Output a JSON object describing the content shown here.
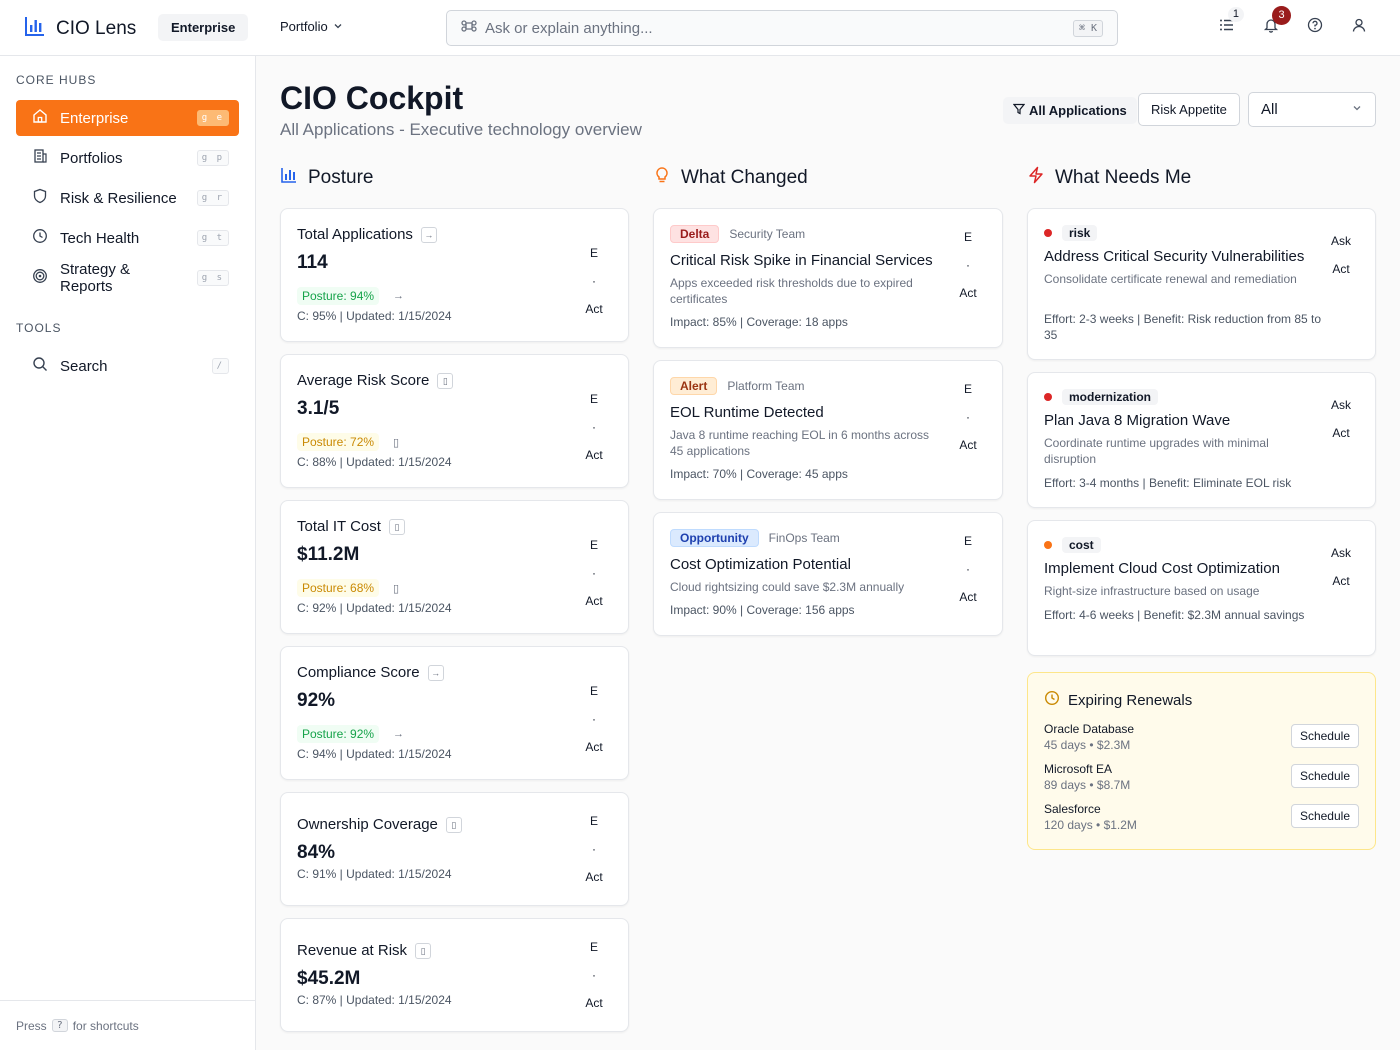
{
  "app": {
    "title": "CIO Lens",
    "env_badge": "Enterprise",
    "portfolio_label": "Portfolio"
  },
  "search": {
    "placeholder": "Ask or explain anything...",
    "shortcut": "⌘ K"
  },
  "top_icons": {
    "tasks_count": "1",
    "notifications_count": "3"
  },
  "sidebar": {
    "core_heading": "CORE HUBS",
    "tools_heading": "TOOLS",
    "items": [
      {
        "label": "Enterprise",
        "shortcut": "g e",
        "icon": "home-icon"
      },
      {
        "label": "Portfolios",
        "shortcut": "g p",
        "icon": "building-icon"
      },
      {
        "label": "Risk & Resilience",
        "shortcut": "g r",
        "icon": "shield-icon"
      },
      {
        "label": "Tech Health",
        "shortcut": "g t",
        "icon": "clock-icon"
      },
      {
        "label": "Strategy & Reports",
        "shortcut": "g s",
        "icon": "target-icon"
      }
    ],
    "tools": [
      {
        "label": "Search",
        "shortcut": "/",
        "icon": "search-icon"
      }
    ],
    "footer": {
      "prefix": "Press",
      "key": "?",
      "suffix": "for shortcuts"
    }
  },
  "header": {
    "title": "CIO Cockpit",
    "subtitle": "All Applications - Executive technology overview",
    "filter_label": "All Applications",
    "risk_button": "Risk Appetite",
    "select_value": "All"
  },
  "sections": {
    "posture": "Posture",
    "changed": "What Changed",
    "needs": "What Needs Me"
  },
  "metrics": [
    {
      "label": "Total Applications",
      "value": "114",
      "posture": "Posture: 94%",
      "trend": "→",
      "meta": "C: 95% | Updated: 1/15/2024",
      "e": "E",
      "dot": "·",
      "act": "Act"
    },
    {
      "label": "Average Risk Score",
      "value": "3.1/5",
      "posture": "Posture: 72%",
      "trend": "▯",
      "meta": "C: 88% | Updated: 1/15/2024",
      "e": "E",
      "dot": "·",
      "act": "Act"
    },
    {
      "label": "Total IT Cost",
      "value": "$11.2M",
      "posture": "Posture: 68%",
      "trend": "▯",
      "meta": "C: 92% | Updated: 1/15/2024",
      "e": "E",
      "dot": "·",
      "act": "Act"
    },
    {
      "label": "Compliance Score",
      "value": "92%",
      "posture": "Posture: 92%",
      "trend": "→",
      "meta": "C: 94% | Updated: 1/15/2024",
      "e": "E",
      "dot": "·",
      "act": "Act"
    },
    {
      "label": "Ownership Coverage",
      "value": "84%",
      "meta": "C: 91% | Updated: 1/15/2024",
      "e": "E",
      "dot": "·",
      "act": "Act"
    },
    {
      "label": "Revenue at Risk",
      "value": "$45.2M",
      "meta": "C: 87% | Updated: 1/15/2024",
      "e": "E",
      "dot": "·",
      "act": "Act"
    }
  ],
  "metric_icons": [
    "→",
    "▯",
    "▯",
    "→",
    "▯",
    "▯"
  ],
  "changes": [
    {
      "tag": "Delta",
      "team": "Security Team",
      "title": "Critical Risk Spike in Financial Services",
      "desc": "Apps exceeded risk thresholds due to expired certificates",
      "meta": "Impact: 85% | Coverage: 18 apps"
    },
    {
      "tag": "Alert",
      "team": "Platform Team",
      "title": "EOL Runtime Detected",
      "desc": "Java 8 runtime reaching EOL in 6 months across 45 applications",
      "meta": "Impact: 70% | Coverage: 45 apps"
    },
    {
      "tag": "Opportunity",
      "team": "FinOps Team",
      "title": "Cost Optimization Potential",
      "desc": "Cloud rightsizing could save $2.3M annually",
      "meta": "Impact: 90% | Coverage: 156 apps"
    }
  ],
  "needs": [
    {
      "tag": "risk",
      "color": "#dc2626",
      "title": "Address Critical Security Vulnerabilities",
      "desc": "Consolidate certificate renewal and remediation",
      "meta": "Effort: 2-3 weeks | Benefit: Risk reduction from 85 to 35",
      "ask": "Ask",
      "act": "Act"
    },
    {
      "tag": "modernization",
      "color": "#dc2626",
      "title": "Plan Java 8 Migration Wave",
      "desc": "Coordinate runtime upgrades with minimal disruption",
      "meta": "Effort: 3-4 months | Benefit: Eliminate EOL risk",
      "ask": "Ask",
      "act": "Act"
    },
    {
      "tag": "cost",
      "color": "#f97316",
      "title": "Implement Cloud Cost Optimization",
      "desc": "Right-size infrastructure based on usage",
      "meta": "Effort: 4-6 weeks | Benefit: $2.3M annual savings",
      "ask": "Ask",
      "act": "Act"
    }
  ],
  "renewals": {
    "title": "Expiring Renewals",
    "items": [
      {
        "name": "Oracle Database",
        "detail": "45 days • $2.3M",
        "button": "Schedule"
      },
      {
        "name": "Microsoft EA",
        "detail": "89 days • $8.7M",
        "button": "Schedule"
      },
      {
        "name": "Salesforce",
        "detail": "120 days • $1.2M",
        "button": "Schedule"
      }
    ]
  },
  "colors": {
    "accent": "#f97316",
    "brand": "#2563eb",
    "good": "#16a34a",
    "warn": "#ca8a04"
  }
}
